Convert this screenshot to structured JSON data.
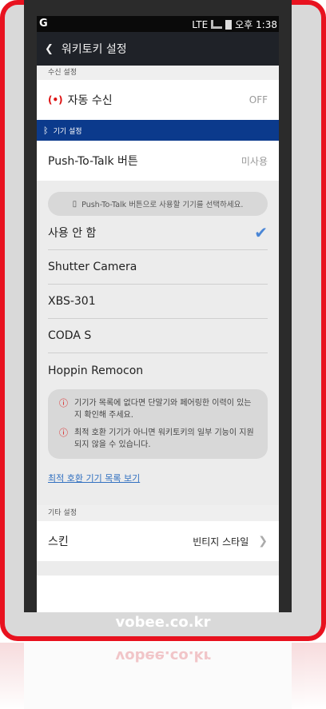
{
  "status_bar": {
    "carrier_logo": "G",
    "network": "LTE",
    "time": "오후 1:38"
  },
  "title_bar": {
    "title": "워키토키 설정"
  },
  "receive_section": {
    "header": "수신 설정",
    "auto_receive_label": "자동 수신",
    "auto_receive_value": "OFF"
  },
  "device_section": {
    "header": "기기 설정",
    "ptt_label": "Push-To-Talk 버튼",
    "ptt_value": "미사용",
    "hint": "Push-To-Talk 버튼으로 사용할 기기를 선택하세요.",
    "devices": [
      {
        "label": "사용 안 함",
        "selected": true
      },
      {
        "label": "Shutter Camera",
        "selected": false
      },
      {
        "label": "XBS-301",
        "selected": false
      },
      {
        "label": "CODA S",
        "selected": false
      },
      {
        "label": "Hoppin Remocon",
        "selected": false
      }
    ],
    "notice_1": "기기가 목록에 없다면 단말기와 페어링한 이력이 있는지 확인해 주세요.",
    "notice_2": "최적 호환 기기가 아니면 워키토키의 일부 기능이 지원되지 않을 수 있습니다.",
    "compat_link": "최적 호환 기기 목록 보기"
  },
  "other_section": {
    "header": "기타 설정",
    "skin_label": "스킨",
    "skin_value": "빈티지 스타일"
  },
  "watermark": "vobee.co.kr",
  "colors": {
    "frame": "#e8121f",
    "accent_blue": "#0b3a8c",
    "check_blue": "#4a86d6",
    "link": "#3170c0"
  }
}
